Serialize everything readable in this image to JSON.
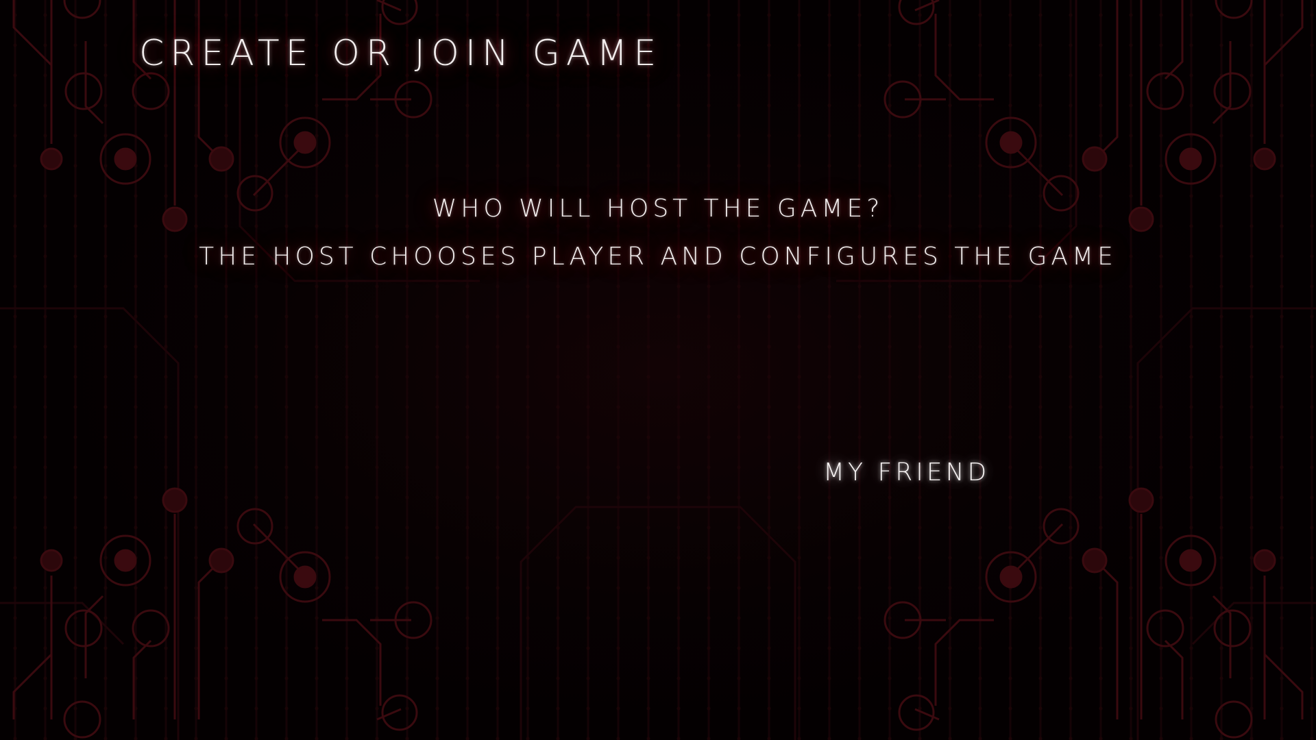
{
  "screen": {
    "title": "CREATE OR JOIN GAME"
  },
  "prompt": {
    "question": "WHO WILL HOST THE GAME?",
    "description": "THE HOST CHOOSES PLAYER AND CONFIGURES THE GAME"
  },
  "options": {
    "my_friend": "MY FRIEND"
  },
  "colors": {
    "background": "#060102",
    "circuit_trace": "#3a0a0f",
    "circuit_node": "#4a0d13",
    "text": "#f3eeee",
    "text_glow": "#d8283c"
  },
  "decor": {
    "background_pattern": "circuit-board"
  }
}
